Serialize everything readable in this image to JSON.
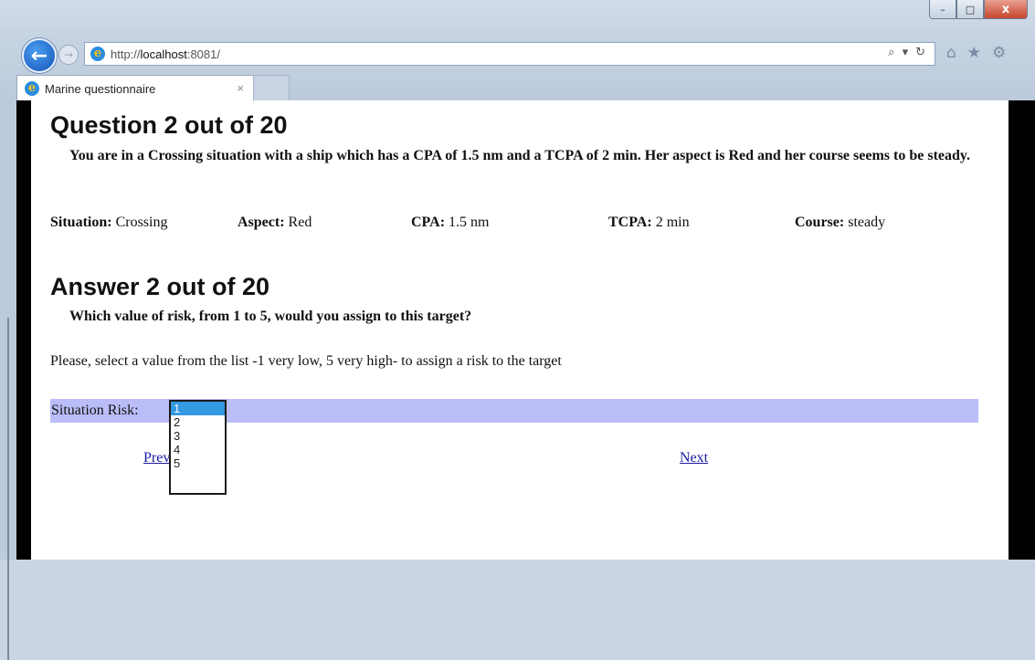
{
  "window": {
    "minimize": "–",
    "maximize": "□",
    "close": "x"
  },
  "nav": {
    "url_prefix": "http://",
    "url_host": "localhost",
    "url_rest": ":8081/",
    "search_glyph": "⌕",
    "refresh_glyph": "↻"
  },
  "tab": {
    "title": "Marine questionnaire",
    "close": "×"
  },
  "question": {
    "heading": "Question 2 out of 20",
    "text": "You are in a Crossing situation with a ship which has a CPA of 1.5 nm and a TCPA of 2 min. Her aspect is Red and her course seems to be steady."
  },
  "facts": {
    "situation_label": "Situation:",
    "situation_value": "Crossing",
    "aspect_label": "Aspect:",
    "aspect_value": "Red",
    "cpa_label": "CPA:",
    "cpa_value": "1.5 nm",
    "tcpa_label": "TCPA:",
    "tcpa_value": "2 min",
    "course_label": "Course:",
    "course_value": "steady"
  },
  "answer": {
    "heading": "Answer 2 out of 20",
    "prompt": "Which value of risk, from 1 to 5, would you assign to this target?",
    "instruction": "Please, select a value from the list -1 very low, 5 very high- to assign a risk to the target",
    "risk_label": "Situation Risk:",
    "options": [
      "1",
      "2",
      "3",
      "4",
      "5"
    ],
    "selected": "1"
  },
  "links": {
    "previous": "Previous",
    "next": "Next"
  }
}
